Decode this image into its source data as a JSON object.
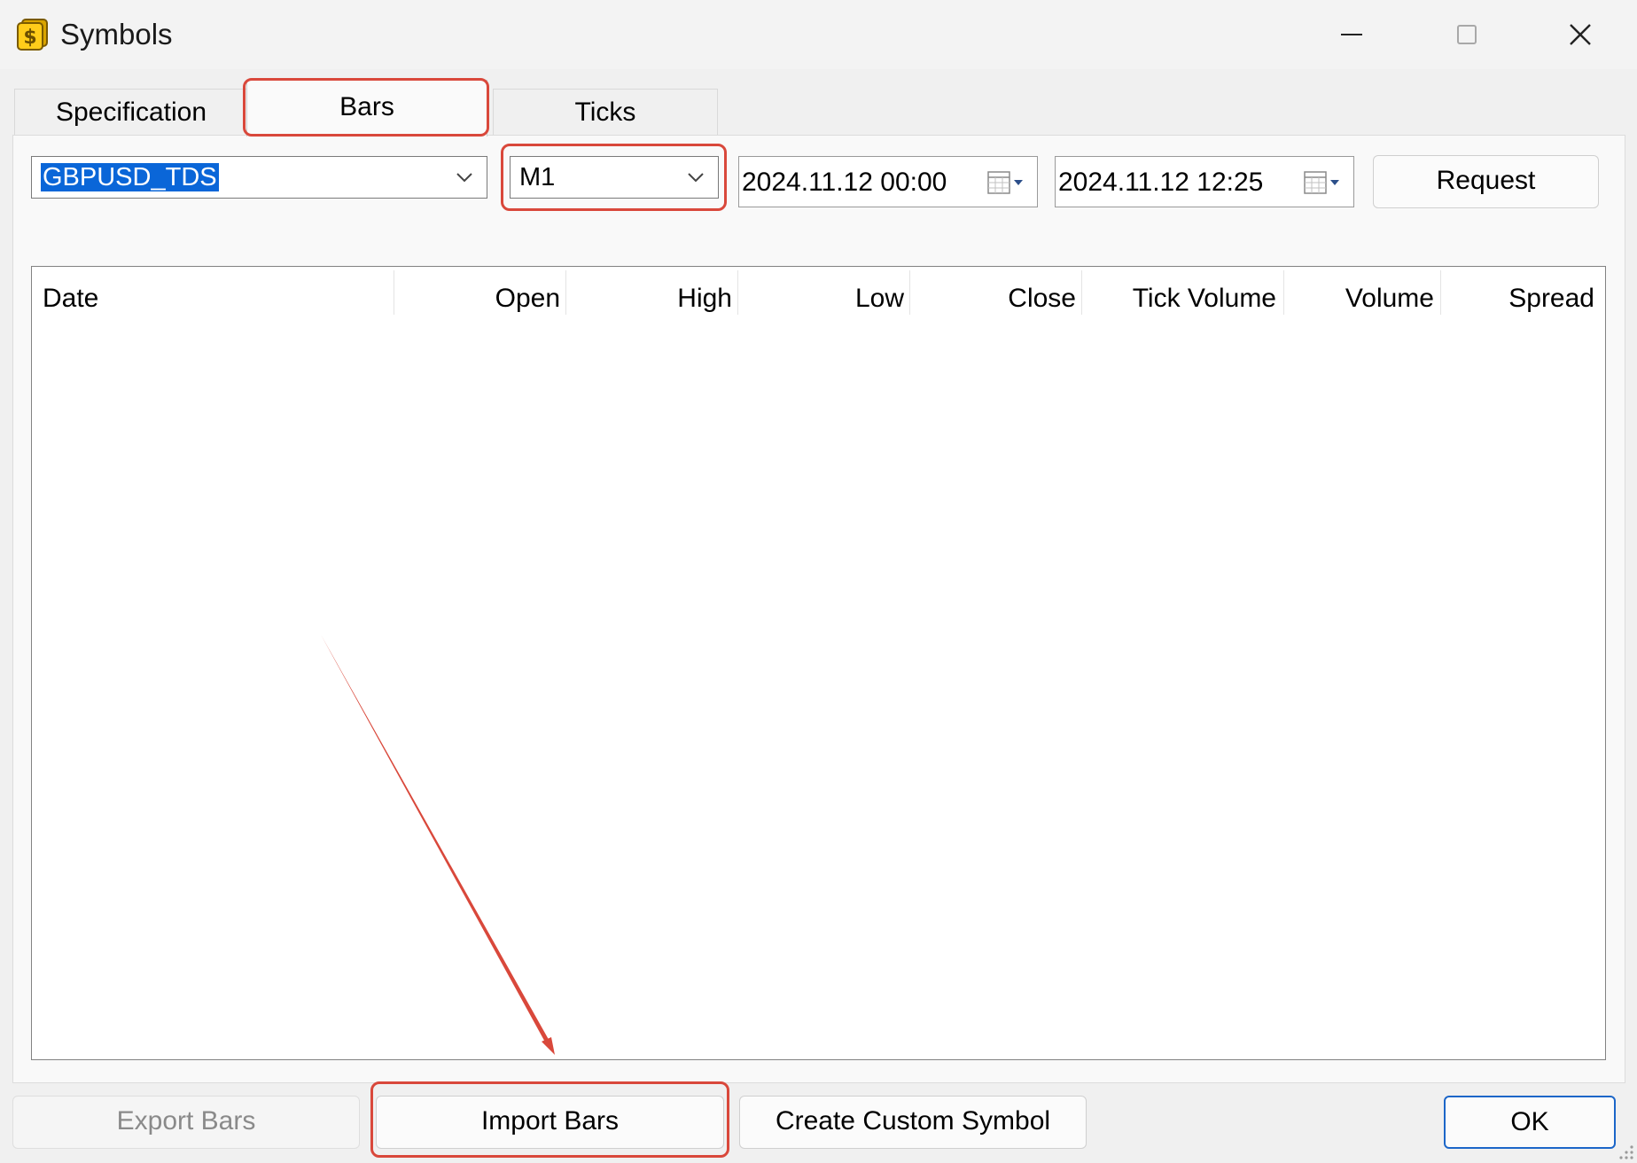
{
  "window": {
    "title": "Symbols",
    "icon": "dollar-coin-icon",
    "controls": [
      "minimize-icon",
      "maximize-icon",
      "close-icon"
    ]
  },
  "tabs": [
    {
      "label": "Specification",
      "active": false
    },
    {
      "label": "Bars",
      "active": true
    },
    {
      "label": "Ticks",
      "active": false
    }
  ],
  "toolbar": {
    "symbol": "GBPUSD_TDS",
    "timeframe": "M1",
    "date_from": "2024.11.12 00:00",
    "date_to": "2024.11.12 12:25",
    "request_label": "Request"
  },
  "table": {
    "columns": [
      "Date",
      "Open",
      "High",
      "Low",
      "Close",
      "Tick Volume",
      "Volume",
      "Spread"
    ],
    "rows": []
  },
  "footer": {
    "export_label": "Export Bars",
    "import_label": "Import Bars",
    "create_label": "Create Custom Symbol",
    "ok_label": "OK"
  },
  "annotations": {
    "highlight_color": "#d9483b"
  }
}
